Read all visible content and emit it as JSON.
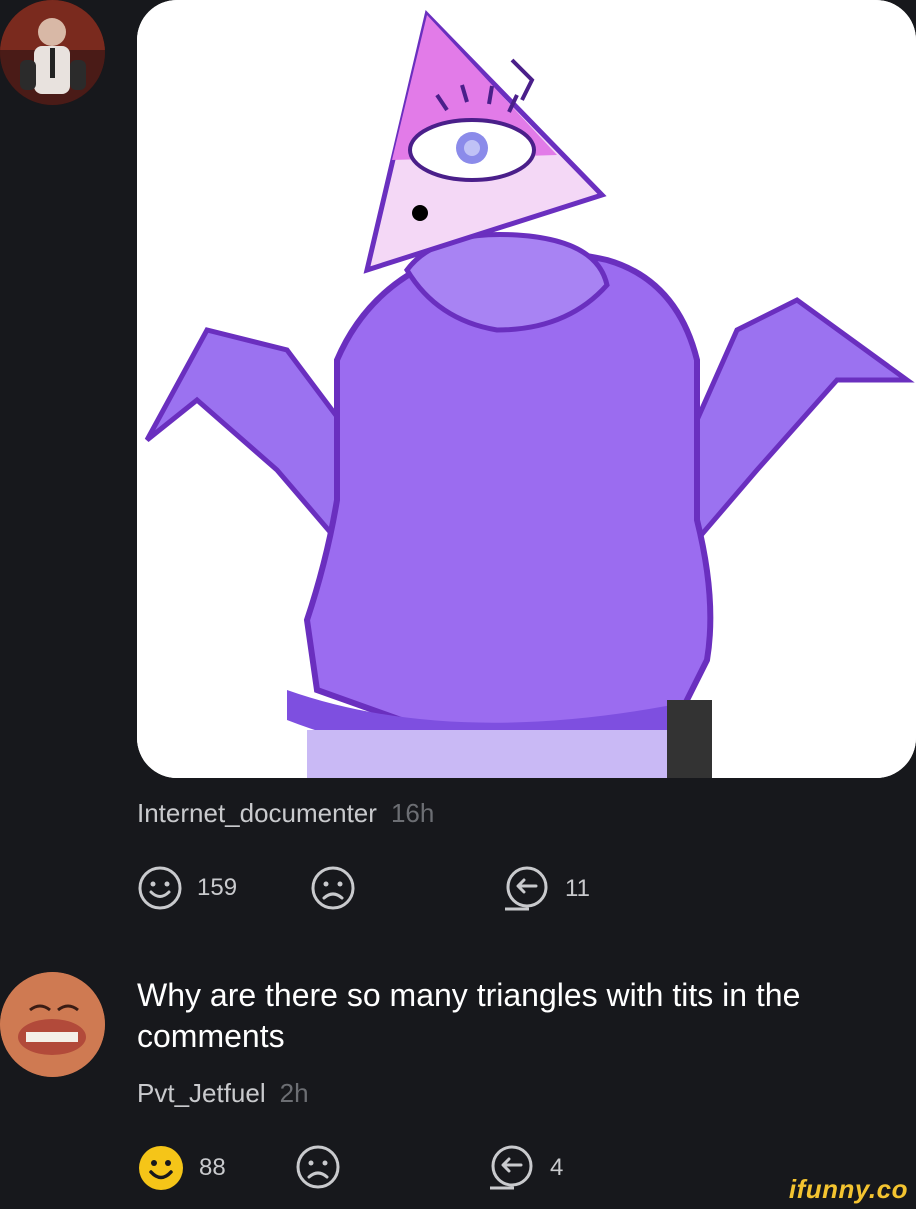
{
  "post": {
    "author": "Internet_documenter",
    "time": "16h",
    "smiles": "159",
    "replies": "11"
  },
  "comment": {
    "text": "Why are there so many triangles with tits in the comments",
    "author": "Pvt_Jetfuel",
    "time": "2h",
    "smiles": "88",
    "replies": "4",
    "smiled": true
  },
  "watermark": "ifunny.co",
  "colors": {
    "background": "#17181c",
    "smile_active": "#f5c518",
    "icon_muted": "#c9cacd",
    "hoodie": "#9b6cf0",
    "triangle": "#e27be8"
  }
}
